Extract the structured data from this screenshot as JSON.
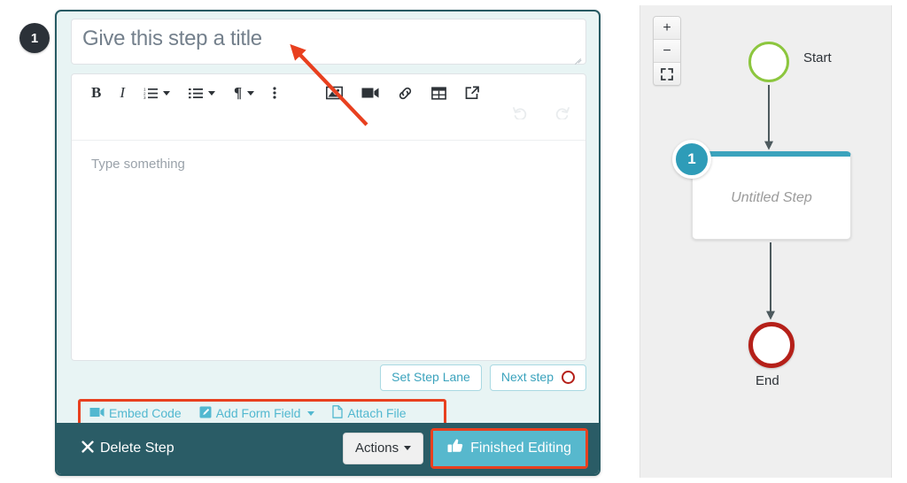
{
  "annotation": {
    "step_number": "1",
    "arrow_color": "#e8401f",
    "highlight_color": "#e8401f"
  },
  "editor": {
    "title_input": {
      "value": "",
      "placeholder": "Give this step a title"
    },
    "toolbar": {
      "bold_label": "B",
      "italic_label": "I",
      "ordered_list_icon": "ordered-list-icon",
      "unordered_list_icon": "unordered-list-icon",
      "paragraph_label": "¶",
      "more_options_icon": "kebab-menu-icon",
      "image_icon": "image-icon",
      "video_icon": "video-icon",
      "link_icon": "link-icon",
      "table_icon": "table-icon",
      "external_link_icon": "external-link-icon",
      "undo_icon": "undo-icon",
      "redo_icon": "redo-icon"
    },
    "body_placeholder": "Type something",
    "set_step_lane_label": "Set Step Lane",
    "next_step_label": "Next step",
    "next_step_icon": "red-ring-icon"
  },
  "attachments": {
    "embed_code_label": "Embed Code",
    "embed_code_icon": "video-icon",
    "add_form_field_label": "Add Form Field",
    "add_form_field_icon": "form-field-icon",
    "attach_file_label": "Attach File",
    "attach_file_icon": "file-icon"
  },
  "footer": {
    "delete_step_label": "Delete Step",
    "delete_step_icon": "close-x-icon",
    "actions_label": "Actions",
    "finished_editing_label": "Finished Editing",
    "finished_editing_icon": "thumbs-up-icon",
    "background_color": "#2a5c66",
    "finished_button_color": "#57b8cd"
  },
  "flow_panel": {
    "zoom_in_label": "+",
    "zoom_out_label": "−",
    "fit_screen_icon": "fit-screen-icon",
    "nodes": {
      "start_label": "Start",
      "start_color": "#8cc63e",
      "step_badge": "1",
      "step_label": "Untitled Step",
      "step_accent_color": "#3ba3bd",
      "end_label": "End",
      "end_color": "#b52019"
    }
  }
}
